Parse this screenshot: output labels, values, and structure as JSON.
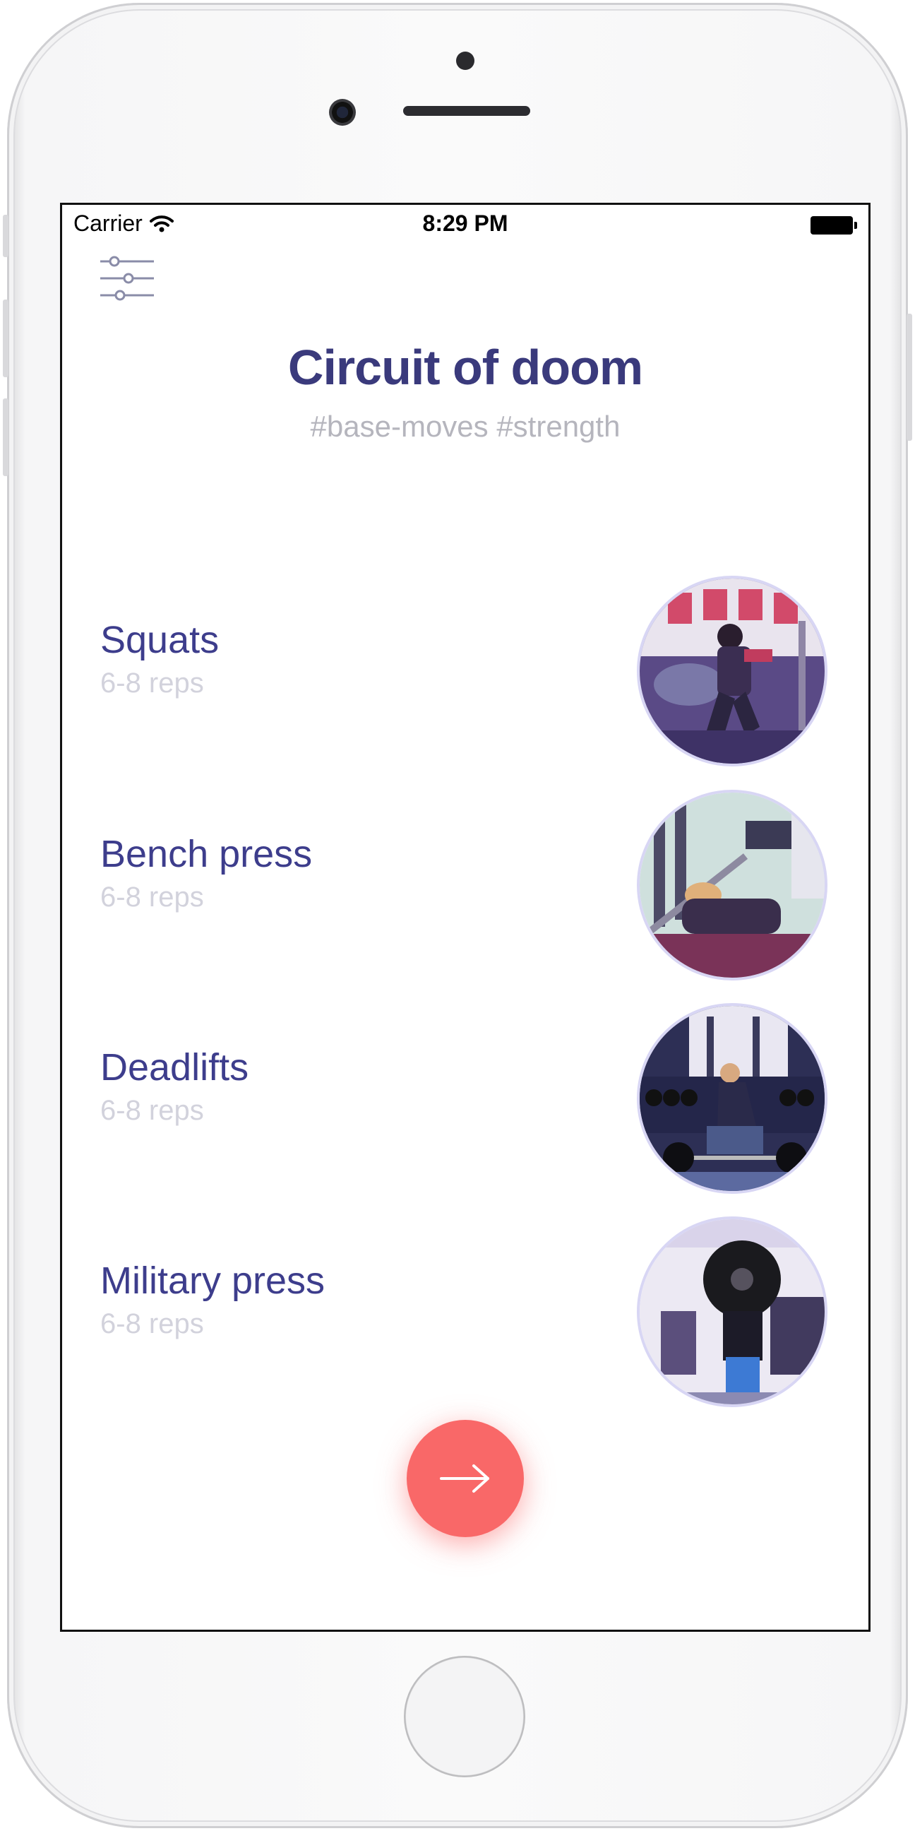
{
  "status_bar": {
    "carrier": "Carrier",
    "time": "8:29 PM",
    "wifi_icon": "wifi-icon",
    "battery_icon": "battery-icon"
  },
  "toolbar": {
    "filter_icon": "sliders-icon"
  },
  "workout": {
    "title": "Circuit of doom",
    "tags": "#base-moves #strength"
  },
  "exercises": [
    {
      "name": "Squats",
      "reps": "6-8 reps",
      "photo_icon": "squat-photo"
    },
    {
      "name": "Bench press",
      "reps": "6-8 reps",
      "photo_icon": "bench-press-photo"
    },
    {
      "name": "Deadlifts",
      "reps": "6-8 reps",
      "photo_icon": "deadlift-photo"
    },
    {
      "name": "Military press",
      "reps": "6-8 reps",
      "photo_icon": "military-press-photo"
    }
  ],
  "next_button": {
    "icon": "arrow-right-icon"
  },
  "colors": {
    "title": "#3a3a7c",
    "exercise_name": "#3d3d8c",
    "reps": "#d2d2dc",
    "tags": "#b5b5bd",
    "accent": "#f96868",
    "photo_border": "#d8d6f4"
  }
}
